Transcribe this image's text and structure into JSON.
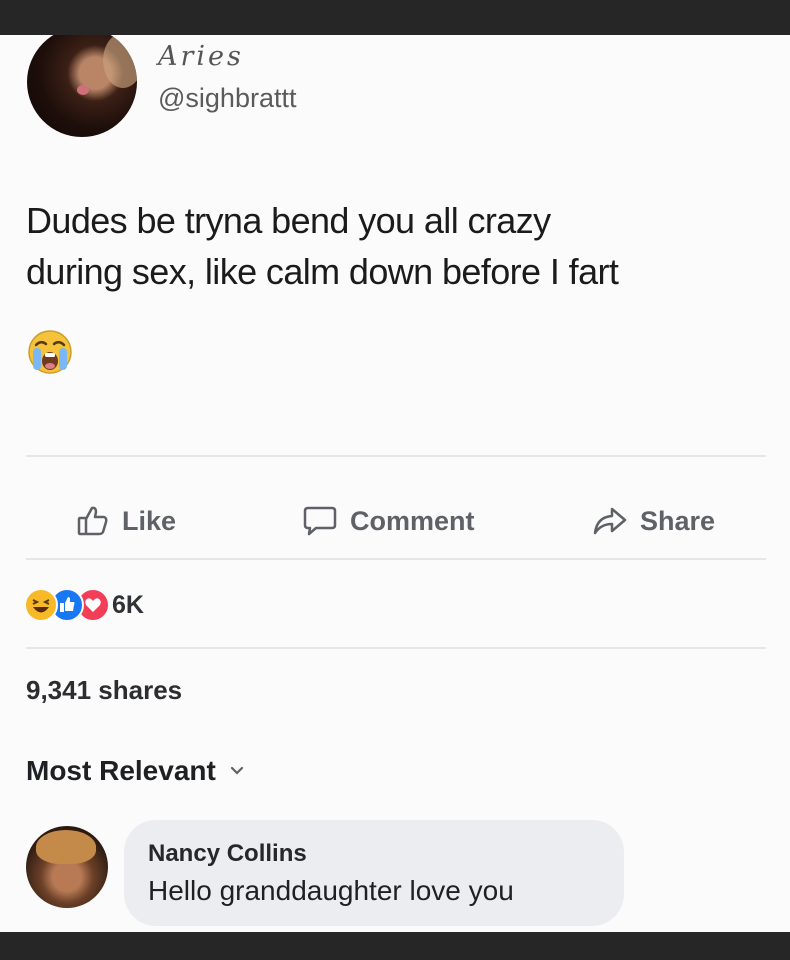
{
  "post": {
    "display_name": "Aries",
    "handle": "@sighbrattt",
    "text_line1": "Dudes be tryna bend you all crazy",
    "text_line2": "during sex, like calm down before I fart",
    "emoji": "loudly-crying-face"
  },
  "actions": {
    "like_label": "Like",
    "comment_label": "Comment",
    "share_label": "Share"
  },
  "reactions": {
    "types": [
      "haha",
      "like",
      "love"
    ],
    "count": "6K"
  },
  "shares_text": "9,341 shares",
  "sort": {
    "label": "Most Relevant",
    "icon": "chevron-down-icon"
  },
  "comment": {
    "author": "Nancy Collins",
    "text": "Hello granddaughter love you"
  },
  "colors": {
    "facebook_blue": "#1877f2",
    "love_red": "#f33e58",
    "haha_yellow": "#f7b928"
  }
}
